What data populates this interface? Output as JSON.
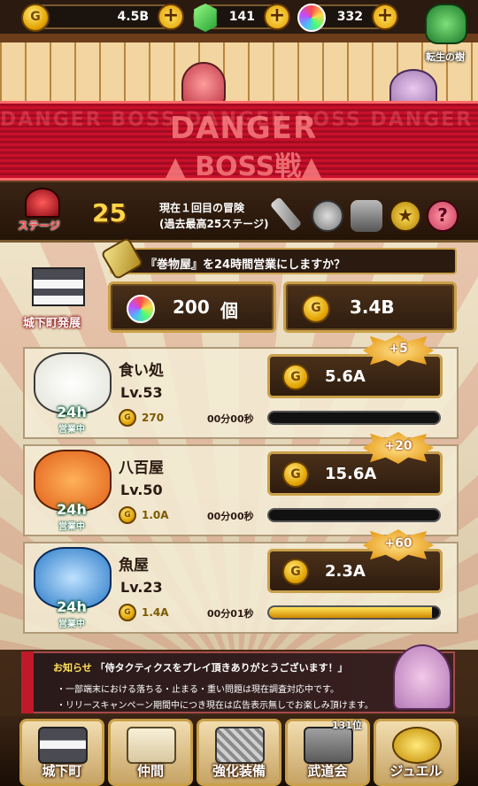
{
  "currency": {
    "gold": "4.5B",
    "gems": "141",
    "jewels": "332"
  },
  "rebirth_tree": "転生の樹",
  "danger": {
    "line1": "DANGER",
    "line2": "▲ BOSS戦▲",
    "bg_text": "DANGER BOSS DANGER BOSS DANGER BOSS DANGER"
  },
  "stage": {
    "label": "ステージ",
    "number": "25",
    "info_line1": "現在１回目の冒険",
    "info_line2": "(過去最高25ステージ)"
  },
  "town": {
    "label": "城下町発展",
    "banner": "『巻物屋』を24時間営業にしますか？",
    "scroll_count": "200",
    "scroll_unit": "個",
    "gold_total": "3.4B"
  },
  "shops": [
    {
      "name": "食い処",
      "level": "Lv.53",
      "earn": "5.6A",
      "bonus": "+5",
      "cost": "270",
      "timer": "00分00秒",
      "progress": 0.0,
      "badge": "24h",
      "status": "営業中"
    },
    {
      "name": "八百屋",
      "level": "Lv.50",
      "earn": "15.6A",
      "bonus": "+20",
      "cost": "1.0A",
      "timer": "00分00秒",
      "progress": 0.0,
      "badge": "24h",
      "status": "営業中"
    },
    {
      "name": "魚屋",
      "level": "Lv.23",
      "earn": "2.3A",
      "bonus": "+60",
      "cost": "1.4A",
      "timer": "00分01秒",
      "progress": 0.96,
      "badge": "24h",
      "status": "営業中"
    }
  ],
  "news": {
    "title": "お知らせ",
    "headline": "「侍タクティクスをプレイ頂きありがとうございます！」",
    "line1": "・一部端末における落ちる・止まる・重い問題は現在調査対応中です。",
    "line2": "・リリースキャンペーン期間中につき現在は広告表示無しでお楽しみ頂けます。"
  },
  "nav": {
    "town": "城下町",
    "party": "仲間",
    "equip": "強化装備",
    "arena": "武道会",
    "arena_rank": "131位",
    "jewel": "ジュエル"
  },
  "coin_glyph": "G"
}
